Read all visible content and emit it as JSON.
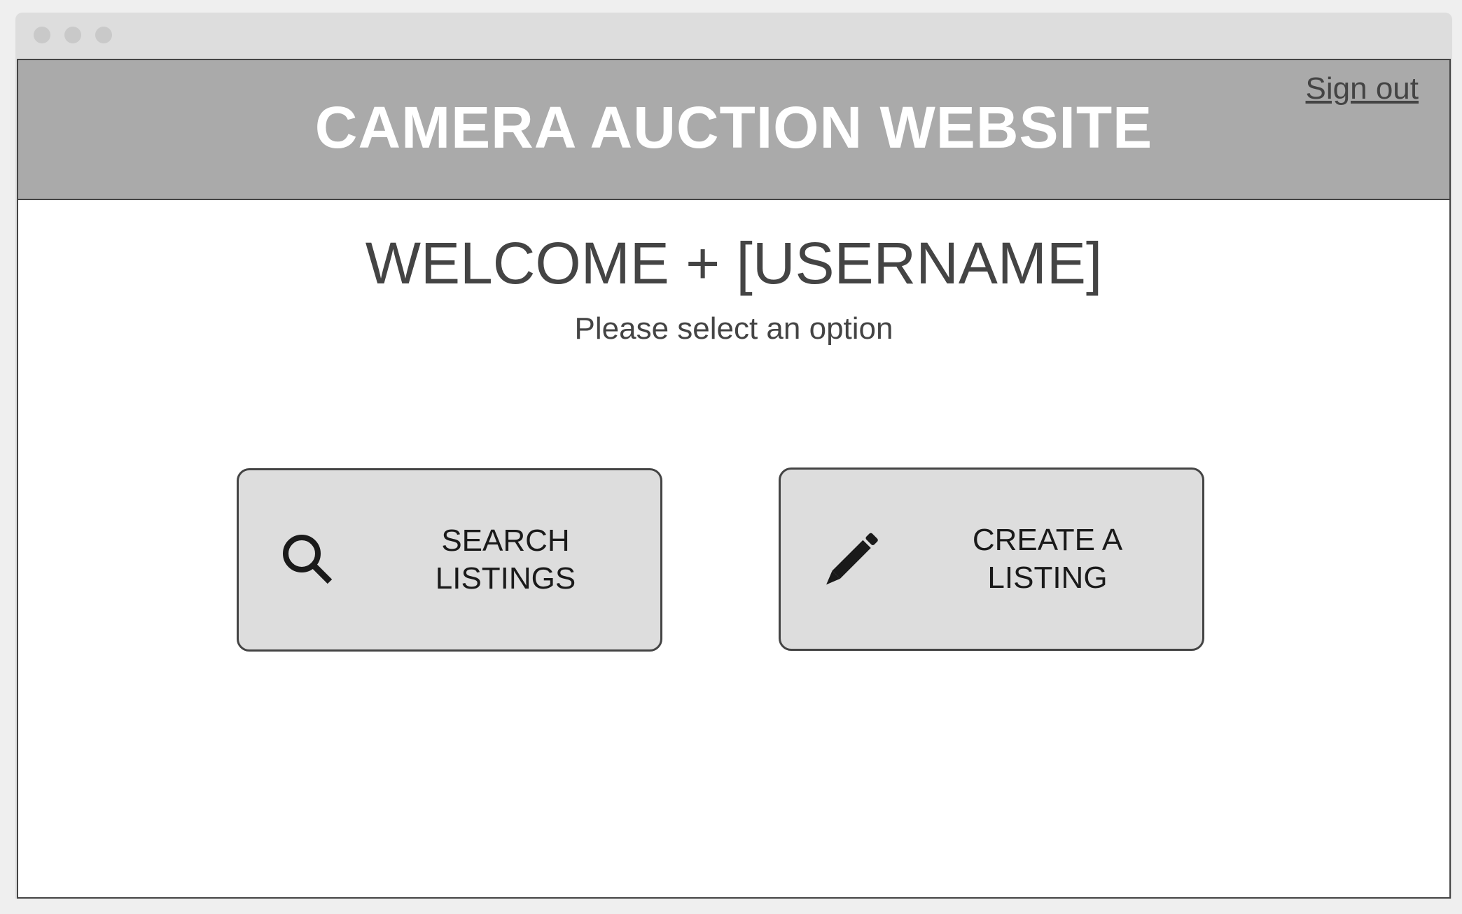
{
  "header": {
    "title": "CAMERA AUCTION WEBSITE",
    "sign_out_label": "Sign out"
  },
  "main": {
    "welcome": "WELCOME + [USERNAME]",
    "subtitle": "Please select an option",
    "options": [
      {
        "label": "SEARCH\nLISTINGS",
        "icon": "search-icon"
      },
      {
        "label": "CREATE A\nLISTING",
        "icon": "pencil-icon"
      }
    ]
  },
  "colors": {
    "header_bg": "#aaaaaa",
    "button_bg": "#dddddd",
    "border": "#444444",
    "text": "#444444"
  }
}
